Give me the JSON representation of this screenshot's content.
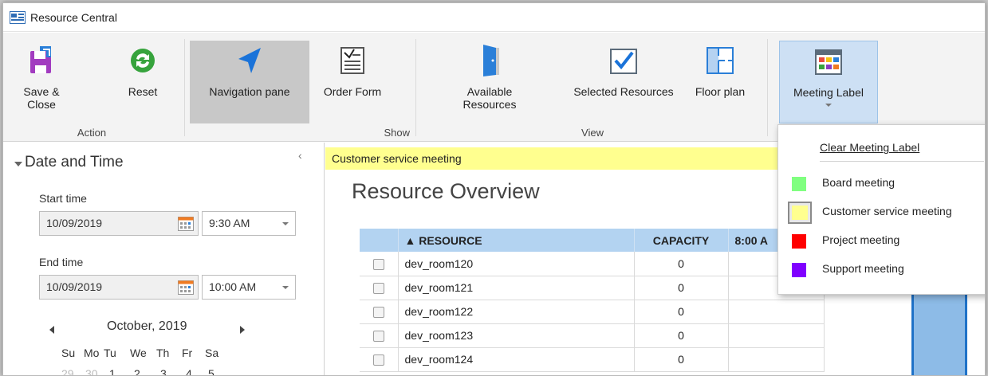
{
  "window": {
    "title": "Resource Central"
  },
  "ribbon": {
    "buttons": {
      "save_close": "Save & Close",
      "reset": "Reset",
      "navigation_pane": "Navigation pane",
      "order_form": "Order Form",
      "available_resources_line1": "Available",
      "available_resources_line2": "Resources",
      "selected_resources": "Selected Resources",
      "floor_plan": "Floor plan",
      "meeting_label": "Meeting Label"
    },
    "groups": {
      "action": "Action",
      "show": "Show",
      "view": "View"
    }
  },
  "left_pane": {
    "section_title": "Date and Time",
    "start_label": "Start time",
    "start_date": "10/09/2019",
    "start_time": "9:30 AM",
    "end_label": "End time",
    "end_date": "10/09/2019",
    "end_time": "10:00 AM",
    "calendar": {
      "month": "October, 2019",
      "weekdays": [
        "Su",
        "Mo",
        "Tu",
        "We",
        "Th",
        "Fr",
        "Sa"
      ],
      "first_row": [
        "29",
        "30",
        "1",
        "2",
        "3",
        "4",
        "5"
      ]
    }
  },
  "main": {
    "label_bar": "Customer service meeting",
    "title": "Resource Overview",
    "table": {
      "headers": {
        "resource": "▲ RESOURCE",
        "capacity": "CAPACITY",
        "time": "8:00 A"
      },
      "rows": [
        {
          "resource": "dev_room120",
          "capacity": "0"
        },
        {
          "resource": "dev_room121",
          "capacity": "0"
        },
        {
          "resource": "dev_room122",
          "capacity": "0"
        },
        {
          "resource": "dev_room123",
          "capacity": "0"
        },
        {
          "resource": "dev_room124",
          "capacity": "0"
        }
      ]
    }
  },
  "meeting_label_menu": {
    "clear": "Clear Meeting Label",
    "items": [
      {
        "label": "Board meeting",
        "color": "#80ff80"
      },
      {
        "label": "Customer service meeting",
        "color": "#ffff8f",
        "selected": true
      },
      {
        "label": "Project meeting",
        "color": "#ff0000"
      },
      {
        "label": "Support meeting",
        "color": "#8000ff"
      }
    ]
  },
  "colors": {
    "label_yellow": "#ffff8f",
    "header_blue": "#b3d3f1",
    "accent_blue": "#1f72c8"
  }
}
